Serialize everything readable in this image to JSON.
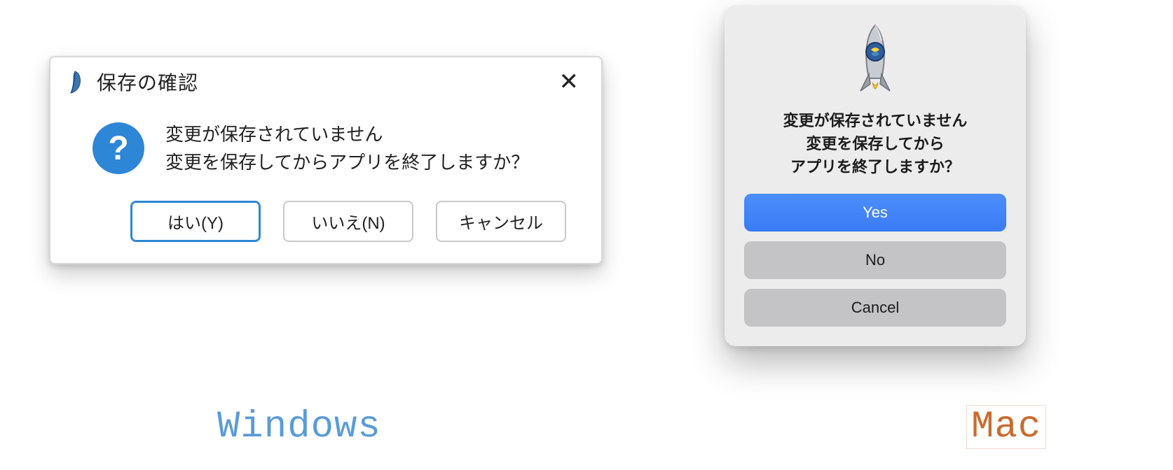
{
  "windows": {
    "title": "保存の確認",
    "message_line1": "変更が保存されていません",
    "message_line2": "変更を保存してからアプリを終了しますか？",
    "buttons": {
      "yes": "はい(Y)",
      "no": "いいえ(N)",
      "cancel": "キャンセル"
    },
    "close_glyph": "✕",
    "question_glyph": "?"
  },
  "mac": {
    "message_line1": "変更が保存されていません",
    "message_line2": "変更を保存してから",
    "message_line3": "アプリを終了しますか？",
    "buttons": {
      "yes": "Yes",
      "no": "No",
      "cancel": "Cancel"
    }
  },
  "captions": {
    "windows": "Windows",
    "mac": "Mac"
  },
  "colors": {
    "win_accent": "#2d86d6",
    "mac_primary": "#3a7bf5",
    "mac_secondary": "#c4c4c7",
    "caption_win": "#5a9bd8",
    "caption_mac": "#cc6a2e"
  }
}
